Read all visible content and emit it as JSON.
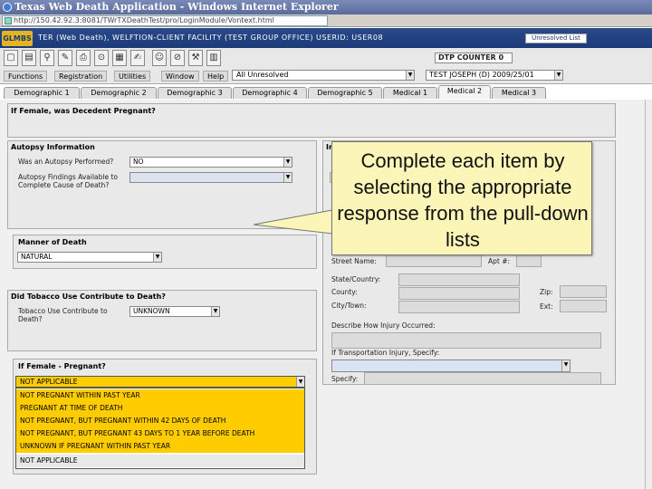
{
  "window": {
    "title": "Texas Web Death Application - Windows Internet Explorer"
  },
  "address": {
    "url": "http://150.42.92.3:8081/TWrTXDeathTest/pro/LoginModule/Vontext.html"
  },
  "banner": {
    "logo": "GLMBS",
    "text": "TER (Web Death), WELFTION-CLIENT FACILITY (TEST GROUP OFFICE) USERID: USER08",
    "unresolved_button": "Unresolved List"
  },
  "menu": {
    "items": [
      "Functions",
      "Registration",
      "Utilities",
      "Window",
      "Help"
    ]
  },
  "toolbar": {
    "case_value": "All Unresolved",
    "dtp_counter": "DTP COUNTER 0",
    "patient": "TEST JOSEPH (D) 2009/25/01"
  },
  "tabs": [
    {
      "label": "Demographic 1"
    },
    {
      "label": "Demographic 2"
    },
    {
      "label": "Demographic 3"
    },
    {
      "label": "Demographic 4"
    },
    {
      "label": "Demographic 5"
    },
    {
      "label": "Medical 1"
    },
    {
      "label": "Medical 2"
    },
    {
      "label": "Medical 3"
    }
  ],
  "active_tab": "Medical 2",
  "form": {
    "pregnant_heading": "If Female, was Decedent Pregnant?",
    "autopsy_heading": "Autopsy Information",
    "autopsy_performed_label": "Was an Autopsy Performed?",
    "autopsy_performed_value": "NO",
    "autopsy_findings_label": "Autopsy Findings Available to Complete Cause of Death?",
    "manner_heading": "Manner of Death",
    "manner_value": "NATURAL",
    "tobacco_heading": "Did Tobacco Use Contribute to Death?",
    "tobacco_label": "Tobacco Use Contribute to Death?",
    "tobacco_value": "UNKNOWN",
    "female_heading": "If Female - Pregnant?",
    "injury_heading_fragment": "In",
    "street_label": "Street Name:",
    "apt_label": "Apt #:",
    "state_label": "State/Country:",
    "county_label": "County:",
    "city_label": "City/Town:",
    "zip_label": "Zip:",
    "ext_label": "Ext:",
    "describe_label": "Describe How Injury Occurred:",
    "transport_label": "If Transportation Injury, Specify:",
    "specify_label": "Specify:"
  },
  "pregnancy_options": {
    "selected": "NOT APPLICABLE",
    "options": [
      "NOT PREGNANT WITHIN PAST YEAR",
      "PREGNANT AT TIME OF DEATH",
      "NOT PREGNANT, BUT PREGNANT WITHIN 42 DAYS OF DEATH",
      "NOT PREGNANT, BUT PREGNANT 43 DAYS TO 1 YEAR BEFORE DEATH",
      "UNKNOWN IF PREGNANT WITHIN PAST YEAR",
      "NOT APPLICABLE"
    ]
  },
  "callout": {
    "text": "Complete each item by selecting the appropriate response from the pull-down lists"
  },
  "colors": {
    "banner": "#1c3a78",
    "highlight": "#ffcc00",
    "callout": "#fbf5b8"
  }
}
